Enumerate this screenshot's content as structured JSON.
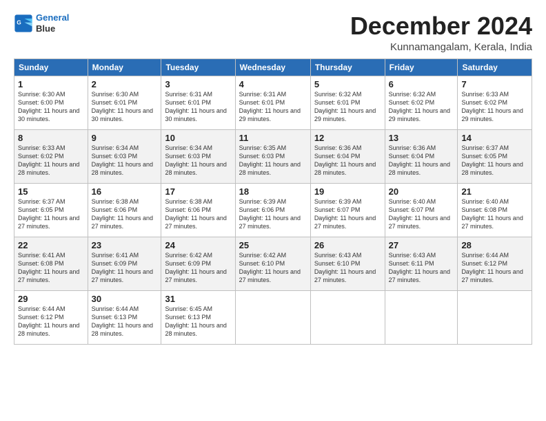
{
  "logo": {
    "line1": "General",
    "line2": "Blue"
  },
  "title": "December 2024",
  "location": "Kunnamangalam, Kerala, India",
  "days_of_week": [
    "Sunday",
    "Monday",
    "Tuesday",
    "Wednesday",
    "Thursday",
    "Friday",
    "Saturday"
  ],
  "weeks": [
    [
      {
        "day": "1",
        "sunrise": "6:30 AM",
        "sunset": "6:00 PM",
        "daylight": "11 hours and 30 minutes."
      },
      {
        "day": "2",
        "sunrise": "6:30 AM",
        "sunset": "6:01 PM",
        "daylight": "11 hours and 30 minutes."
      },
      {
        "day": "3",
        "sunrise": "6:31 AM",
        "sunset": "6:01 PM",
        "daylight": "11 hours and 30 minutes."
      },
      {
        "day": "4",
        "sunrise": "6:31 AM",
        "sunset": "6:01 PM",
        "daylight": "11 hours and 29 minutes."
      },
      {
        "day": "5",
        "sunrise": "6:32 AM",
        "sunset": "6:01 PM",
        "daylight": "11 hours and 29 minutes."
      },
      {
        "day": "6",
        "sunrise": "6:32 AM",
        "sunset": "6:02 PM",
        "daylight": "11 hours and 29 minutes."
      },
      {
        "day": "7",
        "sunrise": "6:33 AM",
        "sunset": "6:02 PM",
        "daylight": "11 hours and 29 minutes."
      }
    ],
    [
      {
        "day": "8",
        "sunrise": "6:33 AM",
        "sunset": "6:02 PM",
        "daylight": "11 hours and 28 minutes."
      },
      {
        "day": "9",
        "sunrise": "6:34 AM",
        "sunset": "6:03 PM",
        "daylight": "11 hours and 28 minutes."
      },
      {
        "day": "10",
        "sunrise": "6:34 AM",
        "sunset": "6:03 PM",
        "daylight": "11 hours and 28 minutes."
      },
      {
        "day": "11",
        "sunrise": "6:35 AM",
        "sunset": "6:03 PM",
        "daylight": "11 hours and 28 minutes."
      },
      {
        "day": "12",
        "sunrise": "6:36 AM",
        "sunset": "6:04 PM",
        "daylight": "11 hours and 28 minutes."
      },
      {
        "day": "13",
        "sunrise": "6:36 AM",
        "sunset": "6:04 PM",
        "daylight": "11 hours and 28 minutes."
      },
      {
        "day": "14",
        "sunrise": "6:37 AM",
        "sunset": "6:05 PM",
        "daylight": "11 hours and 28 minutes."
      }
    ],
    [
      {
        "day": "15",
        "sunrise": "6:37 AM",
        "sunset": "6:05 PM",
        "daylight": "11 hours and 27 minutes."
      },
      {
        "day": "16",
        "sunrise": "6:38 AM",
        "sunset": "6:06 PM",
        "daylight": "11 hours and 27 minutes."
      },
      {
        "day": "17",
        "sunrise": "6:38 AM",
        "sunset": "6:06 PM",
        "daylight": "11 hours and 27 minutes."
      },
      {
        "day": "18",
        "sunrise": "6:39 AM",
        "sunset": "6:06 PM",
        "daylight": "11 hours and 27 minutes."
      },
      {
        "day": "19",
        "sunrise": "6:39 AM",
        "sunset": "6:07 PM",
        "daylight": "11 hours and 27 minutes."
      },
      {
        "day": "20",
        "sunrise": "6:40 AM",
        "sunset": "6:07 PM",
        "daylight": "11 hours and 27 minutes."
      },
      {
        "day": "21",
        "sunrise": "6:40 AM",
        "sunset": "6:08 PM",
        "daylight": "11 hours and 27 minutes."
      }
    ],
    [
      {
        "day": "22",
        "sunrise": "6:41 AM",
        "sunset": "6:08 PM",
        "daylight": "11 hours and 27 minutes."
      },
      {
        "day": "23",
        "sunrise": "6:41 AM",
        "sunset": "6:09 PM",
        "daylight": "11 hours and 27 minutes."
      },
      {
        "day": "24",
        "sunrise": "6:42 AM",
        "sunset": "6:09 PM",
        "daylight": "11 hours and 27 minutes."
      },
      {
        "day": "25",
        "sunrise": "6:42 AM",
        "sunset": "6:10 PM",
        "daylight": "11 hours and 27 minutes."
      },
      {
        "day": "26",
        "sunrise": "6:43 AM",
        "sunset": "6:10 PM",
        "daylight": "11 hours and 27 minutes."
      },
      {
        "day": "27",
        "sunrise": "6:43 AM",
        "sunset": "6:11 PM",
        "daylight": "11 hours and 27 minutes."
      },
      {
        "day": "28",
        "sunrise": "6:44 AM",
        "sunset": "6:12 PM",
        "daylight": "11 hours and 27 minutes."
      }
    ],
    [
      {
        "day": "29",
        "sunrise": "6:44 AM",
        "sunset": "6:12 PM",
        "daylight": "11 hours and 28 minutes."
      },
      {
        "day": "30",
        "sunrise": "6:44 AM",
        "sunset": "6:13 PM",
        "daylight": "11 hours and 28 minutes."
      },
      {
        "day": "31",
        "sunrise": "6:45 AM",
        "sunset": "6:13 PM",
        "daylight": "11 hours and 28 minutes."
      },
      null,
      null,
      null,
      null
    ]
  ],
  "labels": {
    "sunrise": "Sunrise:",
    "sunset": "Sunset:",
    "daylight": "Daylight:"
  }
}
